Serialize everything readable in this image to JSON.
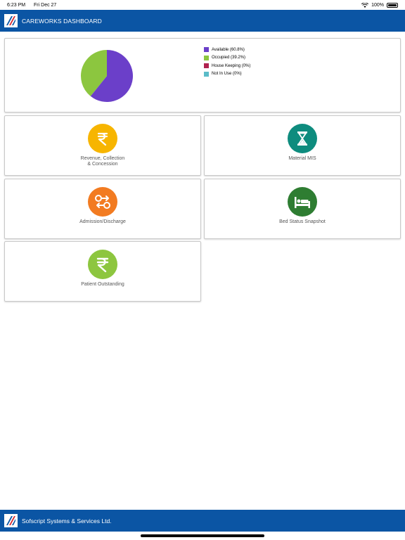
{
  "status_bar": {
    "time": "6:23 PM",
    "date": "Fri Dec 27",
    "battery": "100%"
  },
  "header": {
    "title": "CAREWORKS DASHBOARD"
  },
  "chart_data": {
    "type": "pie",
    "slices": [
      {
        "label": "Available (60.8%)",
        "value": 60.8,
        "color": "#6b3fc9"
      },
      {
        "label": "Occupied (39.2%)",
        "value": 39.2,
        "color": "#8cc63f"
      },
      {
        "label": "House Keeping (0%)",
        "value": 0,
        "color": "#b0234f"
      },
      {
        "label": "Not In Use (0%)",
        "value": 0,
        "color": "#5bbcc8"
      }
    ]
  },
  "tiles": [
    {
      "label": "Revenue, Collection\n& Concession",
      "icon": "rupee-icon",
      "color": "#f7b500"
    },
    {
      "label": "Material MIS",
      "icon": "hourglass-icon",
      "color": "#0e8c7e"
    },
    {
      "label": "Admission/Discharge",
      "icon": "admission-arrows-icon",
      "color": "#f27b21"
    },
    {
      "label": "Bed Status Snapshot",
      "icon": "bed-icon",
      "color": "#2e7d32"
    },
    {
      "label": "Patient Outstanding",
      "icon": "rupee-icon",
      "color": "#8dc63f"
    }
  ],
  "footer": {
    "title": "Sofscript Systems & Services Ltd."
  }
}
